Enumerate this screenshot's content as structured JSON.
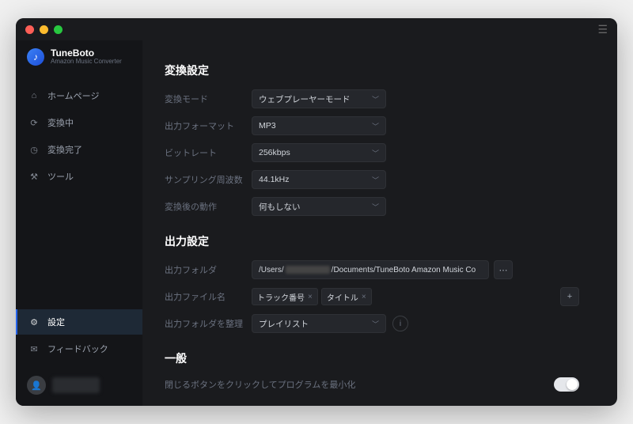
{
  "brand": {
    "title": "TuneBoto",
    "subtitle": "Amazon Music Converter"
  },
  "nav": {
    "home": "ホームページ",
    "converting": "変換中",
    "converted": "変換完了",
    "tools": "ツール",
    "settings": "設定",
    "feedback": "フィードバック"
  },
  "sections": {
    "convert": "変換設定",
    "output": "出力設定",
    "general": "一般"
  },
  "convert": {
    "mode_label": "変換モード",
    "mode_value": "ウェブプレーヤーモード",
    "format_label": "出力フォーマット",
    "format_value": "MP3",
    "bitrate_label": "ビットレート",
    "bitrate_value": "256kbps",
    "samplerate_label": "サンプリング周波数",
    "samplerate_value": "44.1kHz",
    "after_label": "変換後の動作",
    "after_value": "何もしない"
  },
  "output": {
    "folder_label": "出力フォルダ",
    "folder_prefix": "/Users/",
    "folder_suffix": "/Documents/TuneBoto Amazon Music Co",
    "filename_label": "出力ファイル名",
    "tag_track": "トラック番号",
    "tag_title": "タイトル",
    "organize_label": "出力フォルダを整理",
    "organize_value": "プレイリスト"
  },
  "general": {
    "minimize_label": "閉じるボタンをクリックしてプログラムを最小化"
  },
  "icons": {
    "browse": "⋯",
    "add": "+",
    "info": "i"
  }
}
